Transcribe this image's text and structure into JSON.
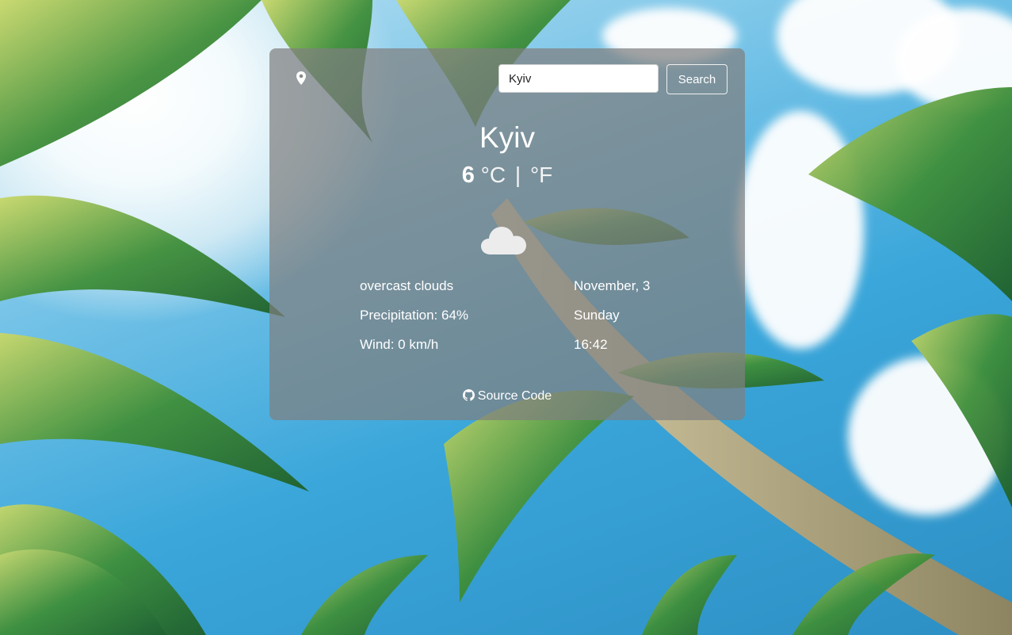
{
  "search": {
    "value": "Kyiv",
    "button_label": "Search"
  },
  "weather": {
    "city": "Kyiv",
    "temperature": "6",
    "unit_c": "°C",
    "separator": "|",
    "unit_f": "°F",
    "icon": "cloud-icon",
    "description": "overcast clouds",
    "precipitation": "Precipitation: 64%",
    "wind": "Wind: 0 km/h",
    "date": "November, 3",
    "day": "Sunday",
    "time": "16:42"
  },
  "footer": {
    "source_label": "Source Code",
    "icon": "github-icon"
  },
  "colors": {
    "card": "#808080",
    "text": "#ffffff",
    "sky": "#3aa6da"
  }
}
